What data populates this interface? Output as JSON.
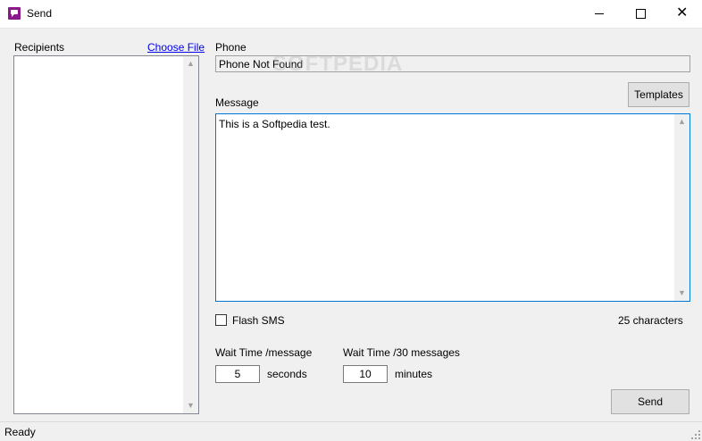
{
  "window": {
    "title": "Send",
    "controls": {
      "minimize_icon": "minimize-icon",
      "maximize_icon": "maximize-icon",
      "close_glyph": "✕"
    }
  },
  "recipients": {
    "label": "Recipients",
    "choose_file_link": "Choose File",
    "items": []
  },
  "phone": {
    "label": "Phone",
    "value": "Phone Not Found"
  },
  "watermark": "SOFTPEDIA",
  "templates_button": "Templates",
  "message": {
    "label": "Message",
    "value": "This is a Softpedia test.",
    "char_count": "25 characters"
  },
  "flash_sms": {
    "label": "Flash SMS",
    "checked": false
  },
  "wait_per_message": {
    "label": "Wait Time /message",
    "value": "5",
    "unit": "seconds"
  },
  "wait_per_30": {
    "label": "Wait Time /30 messages",
    "value": "10",
    "unit": "minutes"
  },
  "send_button": "Send",
  "status": "Ready",
  "colors": {
    "accent_border": "#0078d7",
    "app_icon": "#8a1a8a",
    "link": "#0000ee"
  }
}
